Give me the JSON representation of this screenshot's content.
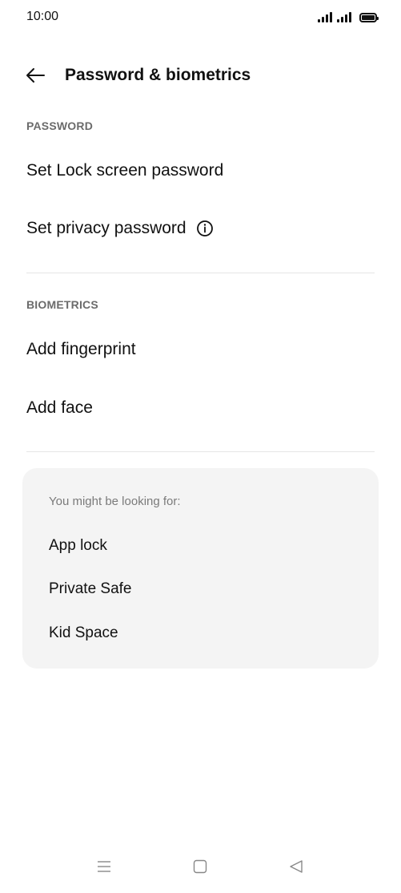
{
  "status_bar": {
    "time": "10:00"
  },
  "header": {
    "title": "Password & biometrics",
    "back_icon": "arrow-left-icon"
  },
  "password_section": {
    "label": "PASSWORD",
    "items": [
      {
        "label": "Set Lock screen password"
      },
      {
        "label": "Set privacy password",
        "icon": "info-icon"
      }
    ]
  },
  "biometrics_section": {
    "label": "BIOMETRICS",
    "items": [
      {
        "label": "Add fingerprint"
      },
      {
        "label": "Add face"
      }
    ]
  },
  "suggestions": {
    "heading": "You might be looking for:",
    "items": [
      {
        "label": "App lock"
      },
      {
        "label": "Private Safe"
      },
      {
        "label": "Kid Space"
      }
    ]
  },
  "nav_bar": {
    "icons": [
      "menu-icon",
      "home-square-icon",
      "back-triangle-icon"
    ]
  },
  "colors": {
    "background": "#ffffff",
    "card": "#f4f4f4",
    "section_label": "#6b6b6b",
    "divider": "#e6e6e6"
  }
}
